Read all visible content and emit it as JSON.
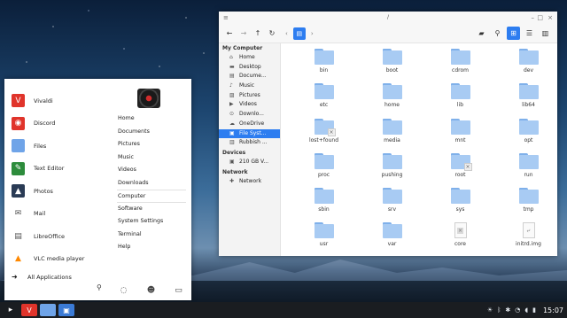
{
  "start_menu": {
    "apps": [
      {
        "label": "Vivaldi",
        "icon": "vivaldi-icon",
        "color": "#e0342b"
      },
      {
        "label": "Discord",
        "icon": "discord-icon",
        "color": "#e0342b"
      },
      {
        "label": "Files",
        "icon": "folder-icon",
        "color": "#6fa4e8"
      },
      {
        "label": "Text Editor",
        "icon": "text-editor-icon",
        "color": "#2d8c3c"
      },
      {
        "label": "Photos",
        "icon": "photos-icon",
        "color": "#2a3b55"
      },
      {
        "label": "Mail",
        "icon": "mail-icon",
        "color": "#ffffff"
      },
      {
        "label": "LibreOffice",
        "icon": "libreoffice-icon",
        "color": "#ffffff"
      },
      {
        "label": "VLC media player",
        "icon": "vlc-icon",
        "color": "#ff8800"
      }
    ],
    "all_apps_label": "All Applications",
    "places": [
      "Home",
      "Documents",
      "Pictures",
      "Music",
      "Videos",
      "Downloads",
      "Computer",
      "Software",
      "System Settings",
      "Terminal",
      "Help"
    ]
  },
  "file_manager": {
    "title": "/",
    "sidebar": {
      "my_computer_header": "My Computer",
      "my_computer_items": [
        {
          "label": "Home",
          "icon": "home-icon"
        },
        {
          "label": "Desktop",
          "icon": "desktop-icon"
        },
        {
          "label": "Docume...",
          "icon": "documents-icon"
        },
        {
          "label": "Music",
          "icon": "music-icon"
        },
        {
          "label": "Pictures",
          "icon": "pictures-icon"
        },
        {
          "label": "Videos",
          "icon": "videos-icon"
        },
        {
          "label": "Downlo...",
          "icon": "downloads-icon"
        },
        {
          "label": "OneDrive",
          "icon": "onedrive-icon"
        },
        {
          "label": "File Syst...",
          "icon": "drive-icon"
        },
        {
          "label": "Rubbish ...",
          "icon": "trash-icon"
        }
      ],
      "devices_header": "Devices",
      "devices_items": [
        {
          "label": "210 GB V...",
          "icon": "drive-icon"
        }
      ],
      "network_header": "Network",
      "network_items": [
        {
          "label": "Network",
          "icon": "network-icon"
        }
      ]
    },
    "items": [
      {
        "label": "bin",
        "kind": "folder"
      },
      {
        "label": "boot",
        "kind": "folder"
      },
      {
        "label": "cdrom",
        "kind": "folder"
      },
      {
        "label": "dev",
        "kind": "folder"
      },
      {
        "label": "etc",
        "kind": "folder"
      },
      {
        "label": "home",
        "kind": "folder"
      },
      {
        "label": "lib",
        "kind": "folder"
      },
      {
        "label": "lib64",
        "kind": "folder"
      },
      {
        "label": "lost+found",
        "kind": "folder-locked"
      },
      {
        "label": "media",
        "kind": "folder"
      },
      {
        "label": "mnt",
        "kind": "folder"
      },
      {
        "label": "opt",
        "kind": "folder"
      },
      {
        "label": "proc",
        "kind": "folder"
      },
      {
        "label": "pushing",
        "kind": "folder"
      },
      {
        "label": "root",
        "kind": "folder-locked"
      },
      {
        "label": "run",
        "kind": "folder"
      },
      {
        "label": "sbin",
        "kind": "folder"
      },
      {
        "label": "srv",
        "kind": "folder"
      },
      {
        "label": "sys",
        "kind": "folder"
      },
      {
        "label": "tmp",
        "kind": "folder"
      },
      {
        "label": "usr",
        "kind": "folder"
      },
      {
        "label": "var",
        "kind": "folder"
      },
      {
        "label": "core",
        "kind": "file-broken"
      },
      {
        "label": "initrd.img",
        "kind": "file-link"
      },
      {
        "label": "",
        "kind": "file-link"
      },
      {
        "label": "",
        "kind": "file-broken"
      },
      {
        "label": "",
        "kind": "file-broken"
      },
      {
        "label": "",
        "kind": "file-link"
      }
    ]
  },
  "taskbar": {
    "clock": "15:07"
  },
  "colors": {
    "accent": "#2d7df0",
    "folder": "#a8cbf3"
  }
}
